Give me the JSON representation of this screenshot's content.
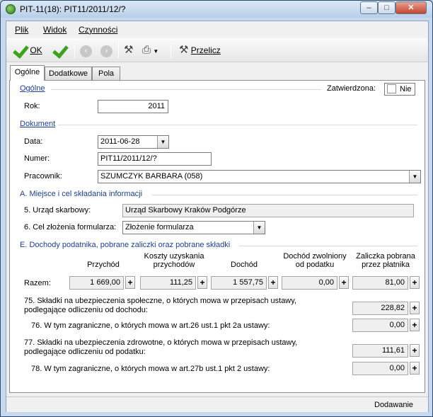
{
  "window": {
    "title": "PIT-11(18): PIT11/2011/12/?"
  },
  "menu": {
    "file": "Plik",
    "view": "Widok",
    "actions": "Czynności"
  },
  "toolbar": {
    "ok_label": "OK",
    "recalc_label": "Przelicz"
  },
  "tabs": [
    "Ogólne",
    "Dodatkowe",
    "Pola"
  ],
  "general": {
    "section_title": "Ogólne",
    "approved_label": "Zatwierdzona:",
    "approved_value": "Nie",
    "year_label": "Rok:",
    "year_value": "2011"
  },
  "document": {
    "section_title": "Dokument",
    "date_label": "Data:",
    "date_value": "2011-06-28",
    "number_label": "Numer:",
    "number_value": "PIT11/2011/12/?",
    "employee_label": "Pracownik:",
    "employee_value": "SZUMCZYK BARBARA (058)"
  },
  "sectionA": {
    "title": "A. Miejsce i cel składania informacji",
    "office_label": "5. Urząd skarbowy:",
    "office_value": "Urząd Skarbowy Kraków Podgórze",
    "purpose_label": "6. Cel złożenia formularza:",
    "purpose_value": "Złożenie formularza"
  },
  "sectionE": {
    "title": "E. Dochody podatnika, pobrane zaliczki oraz pobrane składki",
    "columns": {
      "income": "Przychód",
      "costs_1": "Koszty uzyskania",
      "costs_2": "przychodów",
      "net": "Dochód",
      "exempt_1": "Dochód zwolniony",
      "exempt_2": "od podatku",
      "advance_1": "Zaliczka pobrana",
      "advance_2": "przez płatnika"
    },
    "total_label": "Razem:",
    "totals": {
      "income": "1 669,00",
      "costs": "111,25",
      "net": "1 557,75",
      "exempt": "0,00",
      "advance": "81,00"
    },
    "line75_1": "75. Składki na ubezpieczenia społeczne, o których mowa w przepisach ustawy,",
    "line75_2": "podlegające odliczeniu od dochodu:",
    "line75_value": "228,82",
    "line76": "76. W tym zagraniczne, o których mowa w art.26 ust.1 pkt 2a ustawy:",
    "line76_value": "0,00",
    "line77_1": "77. Składki na ubezpieczenia zdrowotne, o których mowa w przepisach ustawy,",
    "line77_2": "podlegające odliczeniu od podatku:",
    "line77_value": "111,61",
    "line78": "78. W tym zagraniczne, o których mowa w art.27b ust.1 pkt 2 ustawy:",
    "line78_value": "0,00"
  },
  "status": {
    "mode": "Dodawanie"
  }
}
